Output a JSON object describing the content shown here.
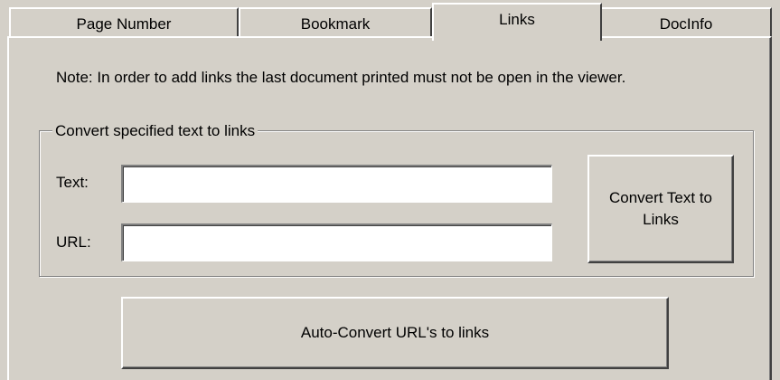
{
  "tabs": [
    {
      "label": "Page Number",
      "active": false
    },
    {
      "label": "Bookmark",
      "active": false
    },
    {
      "label": "Links",
      "active": true
    },
    {
      "label": "DocInfo",
      "active": false
    }
  ],
  "note": "Note: In order to add links the last document printed must not be open in the viewer.",
  "group": {
    "legend": "Convert specified text to links",
    "text_label": "Text:",
    "text_value": "",
    "url_label": "URL:",
    "url_value": "",
    "convert_button_line1": "Convert Text to",
    "convert_button_line2": "Links"
  },
  "auto_convert_button": "Auto-Convert URL's to links"
}
